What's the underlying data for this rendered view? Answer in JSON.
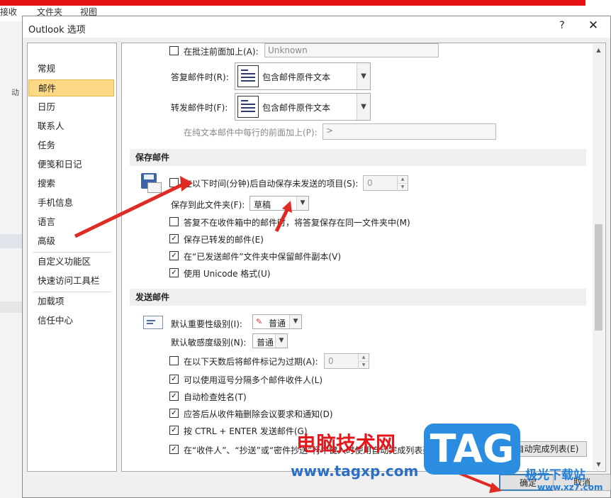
{
  "background": {
    "tabs": [
      "接收",
      "文件夹",
      "视图"
    ],
    "side_label": "动"
  },
  "dialog": {
    "title": "Outlook 选项",
    "help": "?",
    "close": "✕",
    "nav_items": [
      "常规",
      "邮件",
      "日历",
      "联系人",
      "任务",
      "便笺和日记",
      "搜索",
      "手机信息",
      "语言",
      "高级",
      "自定义功能区",
      "快速访问工具栏",
      "加载项",
      "信任中心"
    ],
    "selected_nav": "邮件"
  },
  "reply_section": {
    "prefix_comments_label": "在批注前面加上(A):",
    "prefix_comments_value": "Unknown",
    "reply_label": "答复邮件时(R):",
    "reply_value": "包含邮件原件文本",
    "forward_label": "转发邮件时(F):",
    "forward_value": "包含邮件原件文本",
    "plain_prefix_label": "在纯文本邮件中每行的前面加上(P):",
    "plain_prefix_value": ">"
  },
  "save_section": {
    "header": "保存邮件",
    "autosave_label": "在以下时间(分钟)后自动保存未发送的项目(S):",
    "autosave_value": "0",
    "save_to_label": "保存到此文件夹(F):",
    "save_to_value": "草稿",
    "reply_not_inbox_label": "答复不在收件箱中的邮件时，将答复保存在同一文件夹中(M)",
    "save_forwarded_label": "保存已转发的邮件(E)",
    "keep_sent_label": "在“已发送邮件”文件夹中保留邮件副本(V)",
    "unicode_label": "使用 Unicode 格式(U)"
  },
  "send_section": {
    "header": "发送邮件",
    "importance_label": "默认重要性级别(I):",
    "importance_value": "普通",
    "sensitivity_label": "默认敏感度级别(N):",
    "sensitivity_value": "普通",
    "expire_label": "在以下天数后将邮件标记为过期(A):",
    "expire_value": "0",
    "comma_label": "可以使用逗号分隔多个邮件收件人(L)",
    "check_names_label": "自动检查姓名(T)",
    "delete_meeting_label": "应答后从收件箱删除会议要求和通知(D)",
    "ctrl_enter_label": "按 CTRL + ENTER 发送邮件(G)",
    "autocomplete_label": "在“收件人”、“抄送”或“密件抄送”行中键入时使用自动完成列表建议姓名(U)",
    "clear_autocomplete_button": "空自动完成列表(E)"
  },
  "footer": {
    "ok": "确定",
    "cancel": "取消"
  },
  "watermark": {
    "cn": "电脑技术网",
    "url": "www.tagxp.com",
    "tag": "TAG",
    "site_cn": "极光下载站",
    "site_url": "www.xz7.com"
  },
  "colors": {
    "selected_nav_bg": "#fcd985",
    "arrow_red": "#e02a24",
    "watermark_red": "#e4171b",
    "watermark_blue": "#2a8de0"
  }
}
